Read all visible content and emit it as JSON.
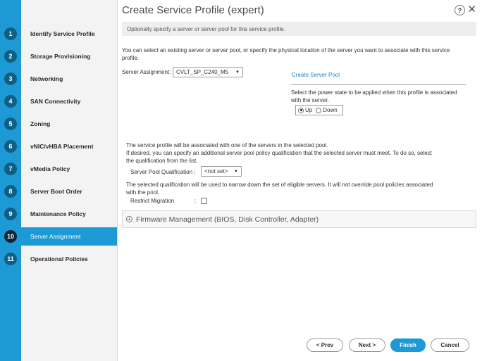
{
  "title": "Create Service Profile (expert)",
  "help_label": "?",
  "close_label": "✕",
  "info_text": "Optionally specify a server or server pool for this service profile.",
  "steps": [
    {
      "num": "1",
      "label": "Identify Service Profile"
    },
    {
      "num": "2",
      "label": "Storage Provisioning"
    },
    {
      "num": "3",
      "label": "Networking"
    },
    {
      "num": "4",
      "label": "SAN Connectivity"
    },
    {
      "num": "5",
      "label": "Zoning"
    },
    {
      "num": "6",
      "label": "vNIC/vHBA Placement"
    },
    {
      "num": "7",
      "label": "vMedia Policy"
    },
    {
      "num": "8",
      "label": "Server Boot Order"
    },
    {
      "num": "9",
      "label": "Maintenance Policy"
    },
    {
      "num": "10",
      "label": "Server Assignment"
    },
    {
      "num": "11",
      "label": "Operational Policies"
    }
  ],
  "intro_line1": "You can select an existing server or server pool, or specify the physical location of the server you want to associate with this service",
  "intro_line2": "profile.",
  "server_assignment_label": "Server Assignment:",
  "server_assignment_value": "CVLT_SP_C240_M5",
  "create_server_pool_link": "Create Server Pool",
  "power_state_line1": "Select the power state to be applied when this profile is associated",
  "power_state_line2": "with the server.",
  "power_up_label": "Up",
  "power_down_label": "Down",
  "pool_line1": "The service profile will be associated with one of the servers in the selected pool.",
  "pool_line2": "If desired, you can specify an additional server pool policy qualification that the selected server must meet. To do so, select",
  "pool_line3": "the qualification from the list.",
  "qualification_label": "Server Pool Qualification :",
  "qualification_value": "<not set>",
  "narrow_line1": "The selected qualification will be used to narrow down the set of eligible servers. It will not override pool policies associated",
  "narrow_line2": "with the pool.",
  "restrict_migration_label": "Restrict Migration",
  "restrict_colon": ":",
  "firmware_label": "Firmware Management (BIOS, Disk Controller, Adapter)",
  "buttons": {
    "prev": "< Prev",
    "next": "Next >",
    "finish": "Finish",
    "cancel": "Cancel"
  },
  "colors": {
    "accent": "#1d9ad6",
    "step_number_bg": "#0f5f85",
    "active_number_bg": "#0b2436"
  }
}
